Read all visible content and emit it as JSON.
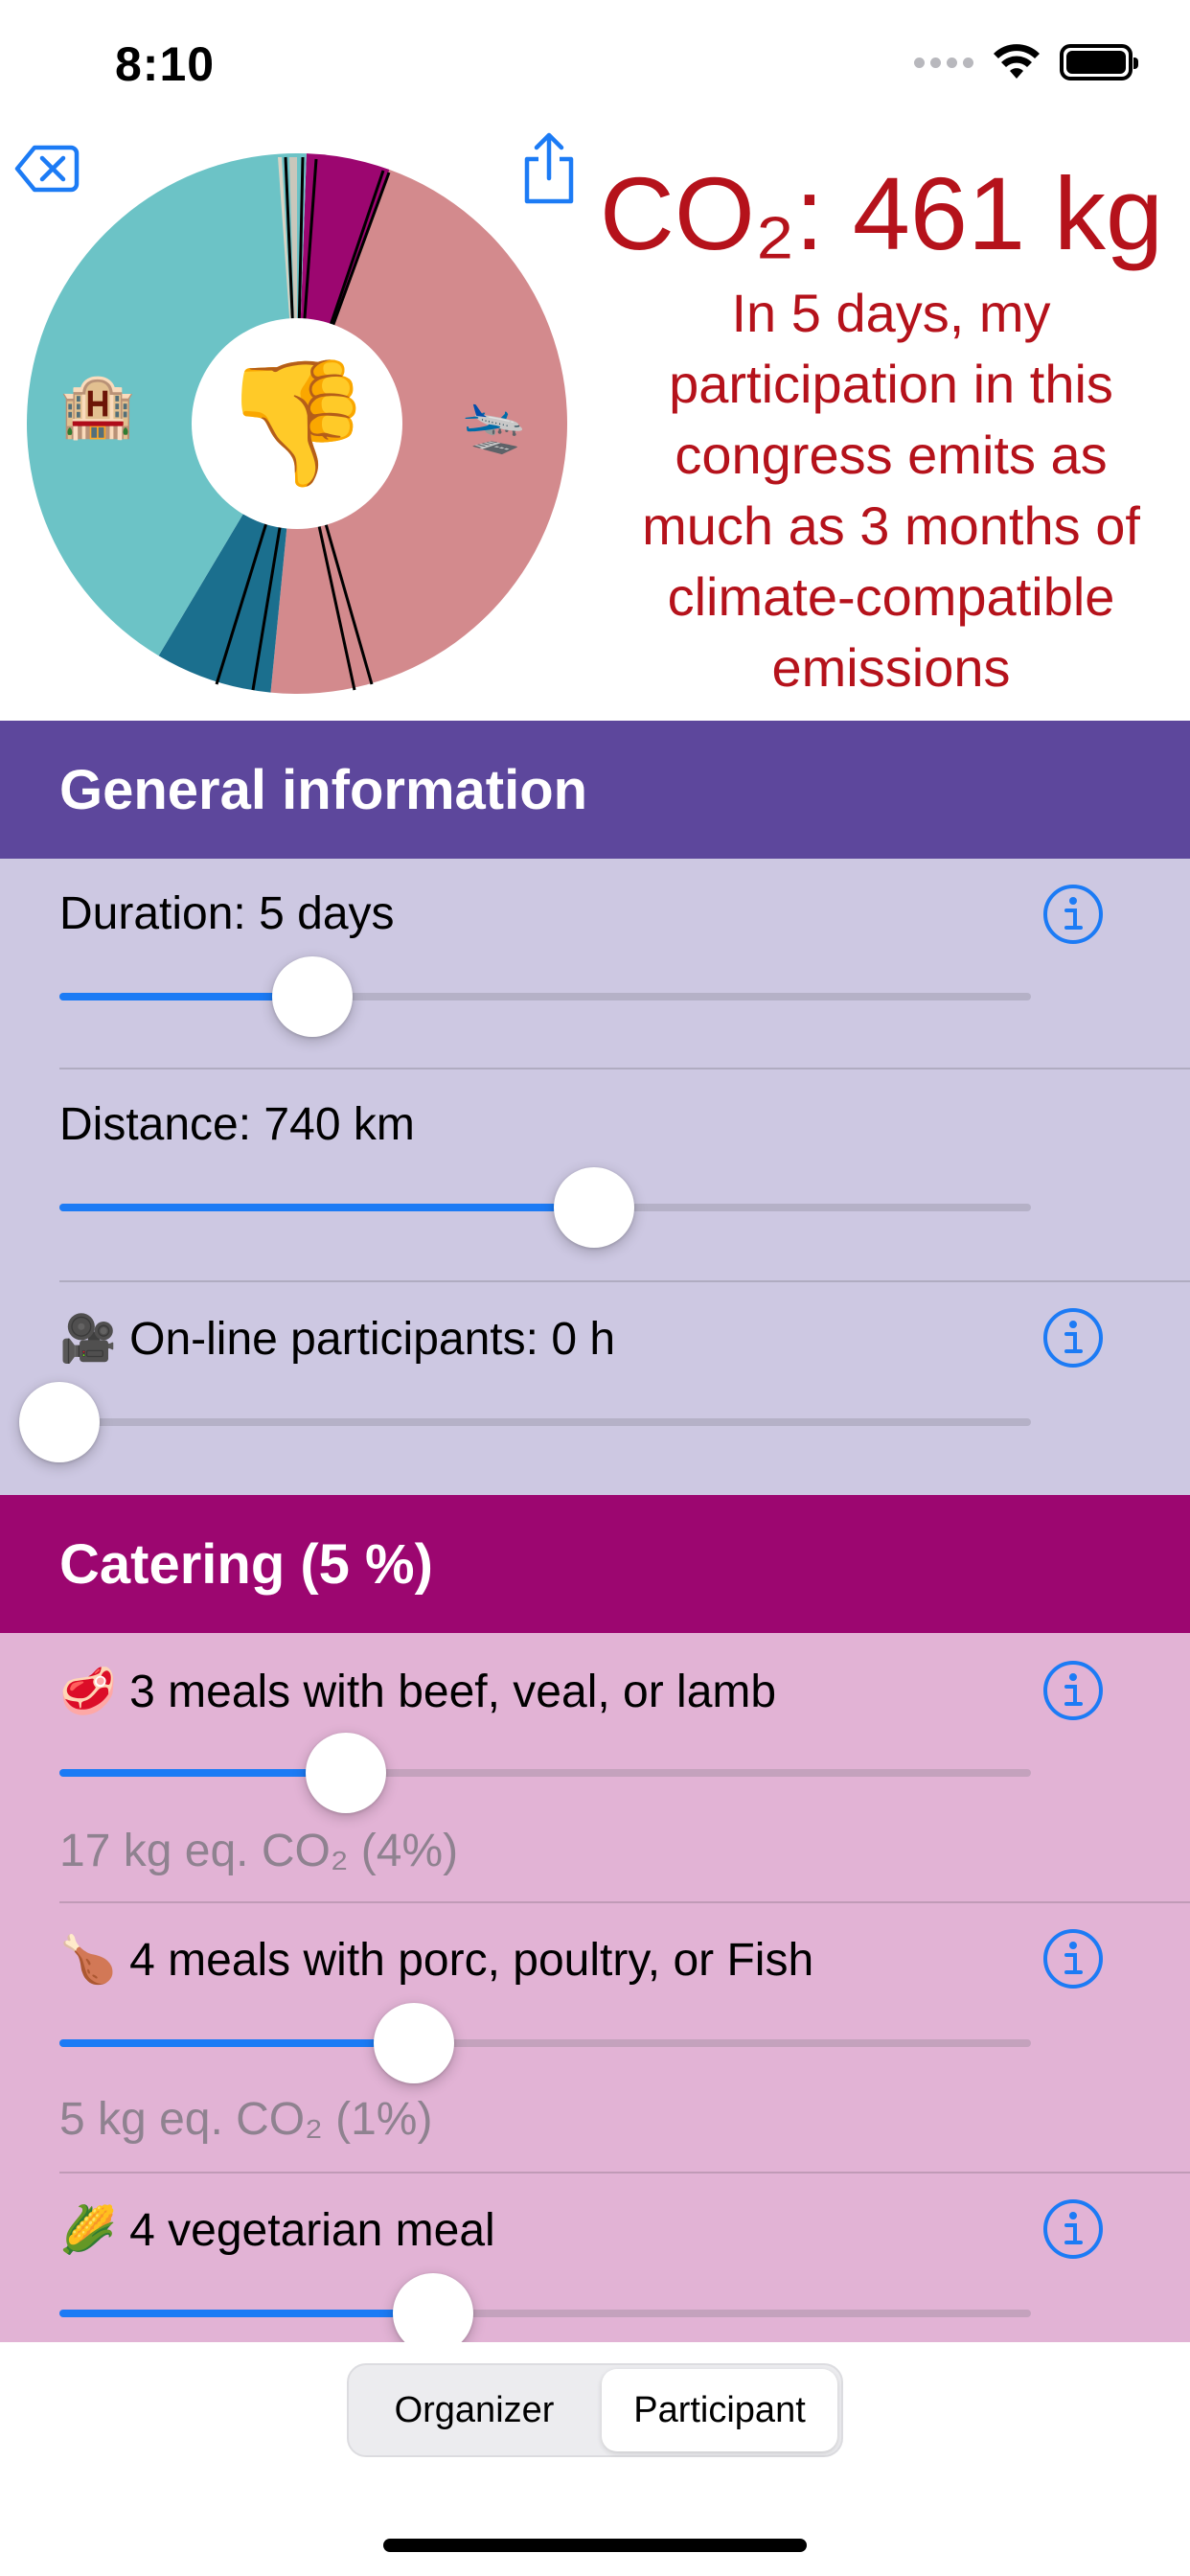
{
  "status_bar": {
    "time": "8:10"
  },
  "header": {
    "co2_title": "CO₂: 461 kg",
    "message": "In 5 days, my participation in this congress emits as much as 3 months of climate-compatible emissions",
    "center_emoji": "👎",
    "hotel_emoji": "🏨",
    "plane_emoji": "🛬"
  },
  "pie_chart": {
    "segments": [
      {
        "name": "catering",
        "share": 0.05,
        "color": "#9c0670"
      },
      {
        "name": "travel",
        "share": 0.46,
        "color": "#d38a8d"
      },
      {
        "name": "other",
        "share": 0.07,
        "color": "#1b6f8e"
      },
      {
        "name": "hotel",
        "share": 0.42,
        "color": "#6cc3c6"
      }
    ]
  },
  "general": {
    "title": "General information",
    "duration": {
      "label": "Duration: 5 days",
      "value": 0.26
    },
    "distance": {
      "label": "Distance: 740 km",
      "value": 0.55
    },
    "online": {
      "emoji": "🎥",
      "label": "On-line participants: 0 h",
      "value": 0.0
    }
  },
  "catering": {
    "title": "Catering (5 %)",
    "beef": {
      "emoji": "🥩",
      "label": "3 meals with beef, veal, or lamb",
      "sub": "17 kg eq. CO₂ (4%)",
      "value": 0.295
    },
    "poultry": {
      "emoji": "🍗",
      "label": "4 meals with porc, poultry, or Fish",
      "sub": "5 kg eq. CO₂ (1%)",
      "value": 0.365
    },
    "veg": {
      "emoji": "🌽",
      "label": "4 vegetarian meal",
      "value": 0.385
    }
  },
  "segmented": {
    "organizer": "Organizer",
    "participant": "Participant",
    "selected": "participant"
  },
  "colors": {
    "accent": "#1c7bf5",
    "alert": "#b5121b",
    "general": "#5d479c",
    "catering": "#9c0670"
  }
}
